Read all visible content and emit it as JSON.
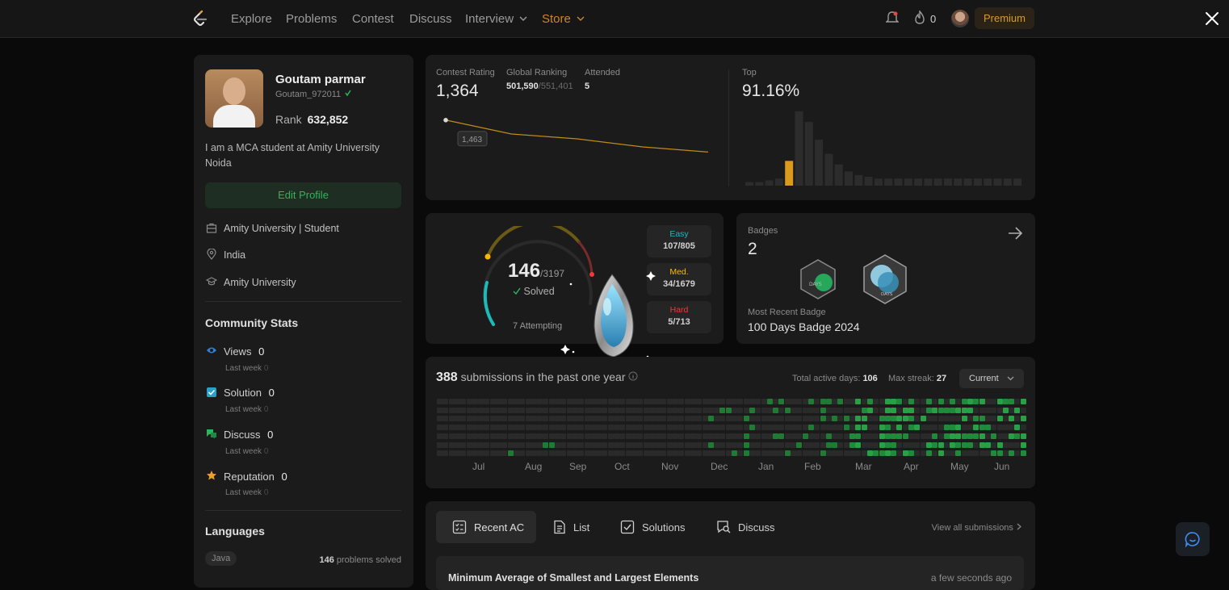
{
  "nav": {
    "items": [
      "Explore",
      "Problems",
      "Contest",
      "Discuss",
      "Interview",
      "Store"
    ],
    "streak_count": "0",
    "premium_label": "Premium"
  },
  "profile": {
    "name": "Goutam parmar",
    "username": "Goutam_972011",
    "rank_label": "Rank",
    "rank_value": "632,852",
    "bio": "I am a MCA student at Amity University Noida",
    "edit_label": "Edit Profile",
    "info": [
      "Amity University | Student",
      "India",
      "Amity University"
    ]
  },
  "community": {
    "title": "Community Stats",
    "stats": [
      {
        "label": "Views",
        "value": "0",
        "sub": "Last week",
        "sub_value": "0"
      },
      {
        "label": "Solution",
        "value": "0",
        "sub": "Last week",
        "sub_value": "0"
      },
      {
        "label": "Discuss",
        "value": "0",
        "sub": "Last week",
        "sub_value": "0"
      },
      {
        "label": "Reputation",
        "value": "0",
        "sub": "Last week",
        "sub_value": "0"
      }
    ]
  },
  "languages": {
    "title": "Languages",
    "items": [
      {
        "name": "Java",
        "count": "146",
        "suffix": "problems solved"
      }
    ]
  },
  "contest": {
    "rating_label": "Contest Rating",
    "rating_value": "1,364",
    "global_label": "Global Ranking",
    "global_value": "501,590",
    "global_total": "/551,401",
    "attended_label": "Attended",
    "attended_value": "5",
    "tooltip_value": "1,463",
    "top_label": "Top",
    "top_value": "91.16%"
  },
  "contest_chart": {
    "points": [
      1463,
      1420,
      1405,
      1380,
      1364
    ],
    "histogram": [
      2,
      2,
      3,
      4,
      14,
      42,
      36,
      26,
      18,
      12,
      8,
      6,
      5,
      4,
      4,
      4,
      4,
      4,
      4,
      4,
      4,
      4,
      4,
      4,
      4,
      4,
      4,
      4
    ],
    "highlight_index": 4
  },
  "solved": {
    "count": "146",
    "total": "/3197",
    "solved_label": "Solved",
    "attempting": "7 Attempting",
    "levels": [
      {
        "label": "Easy",
        "value": "107/805",
        "color": "#1cbaba"
      },
      {
        "label": "Med.",
        "value": "34/1679",
        "color": "#ffb700"
      },
      {
        "label": "Hard",
        "value": "5/713",
        "color": "#f63737"
      }
    ]
  },
  "badges": {
    "title": "Badges",
    "count": "2",
    "recent_label": "Most Recent Badge",
    "recent_name": "100 Days Badge 2024"
  },
  "submissions": {
    "count": "388",
    "text": "submissions in the past one year",
    "active_label": "Total active days:",
    "active_value": "106",
    "streak_label": "Max streak:",
    "streak_value": "27",
    "select_value": "Current",
    "months": [
      "Jul",
      "Aug",
      "Sep",
      "Oct",
      "Nov",
      "Dec",
      "Jan",
      "Feb",
      "Mar",
      "Apr",
      "May",
      "Jun"
    ]
  },
  "tabs": {
    "items": [
      "Recent AC",
      "List",
      "Solutions",
      "Discuss"
    ],
    "view_all": "View all submissions",
    "recent_problem": "Minimum Average of Smallest and Largest Elements",
    "recent_time": "a few seconds ago"
  }
}
